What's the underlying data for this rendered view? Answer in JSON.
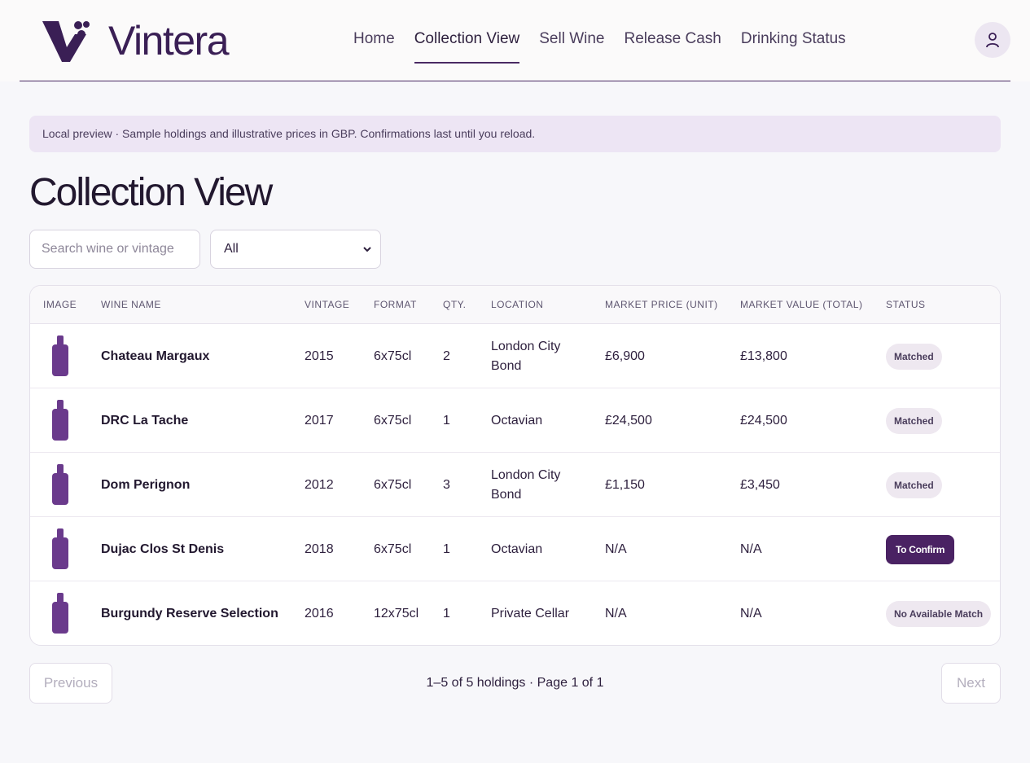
{
  "brand": {
    "name": "Vintera"
  },
  "nav": {
    "items": [
      {
        "label": "Home",
        "active": false
      },
      {
        "label": "Collection View",
        "active": true
      },
      {
        "label": "Sell Wine",
        "active": false
      },
      {
        "label": "Release Cash",
        "active": false
      },
      {
        "label": "Drinking Status",
        "active": false
      }
    ]
  },
  "banner": {
    "text": "Local preview · Sample holdings and illustrative prices in GBP. Confirmations last until you reload."
  },
  "page": {
    "title": "Collection View"
  },
  "filters": {
    "search_placeholder": "Search wine or vintage",
    "select_value": "All"
  },
  "table": {
    "columns": [
      "IMAGE",
      "WINE NAME",
      "VINTAGE",
      "FORMAT",
      "QTY.",
      "LOCATION",
      "MARKET PRICE (UNIT)",
      "MARKET VALUE (TOTAL)",
      "STATUS"
    ],
    "rows": [
      {
        "name": "Chateau Margaux",
        "vintage": "2015",
        "format": "6x75cl",
        "qty": "2",
        "location": "London City Bond",
        "price": "£6,900",
        "value": "£13,800",
        "status": "Matched",
        "status_kind": "matched"
      },
      {
        "name": "DRC La Tache",
        "vintage": "2017",
        "format": "6x75cl",
        "qty": "1",
        "location": "Octavian",
        "price": "£24,500",
        "value": "£24,500",
        "status": "Matched",
        "status_kind": "matched"
      },
      {
        "name": "Dom Perignon",
        "vintage": "2012",
        "format": "6x75cl",
        "qty": "3",
        "location": "London City Bond",
        "price": "£1,150",
        "value": "£3,450",
        "status": "Matched",
        "status_kind": "matched"
      },
      {
        "name": "Dujac Clos St Denis",
        "vintage": "2018",
        "format": "6x75cl",
        "qty": "1",
        "location": "Octavian",
        "price": "N/A",
        "value": "N/A",
        "status": "To Confirm",
        "status_kind": "confirm"
      },
      {
        "name": "Burgundy Reserve Selection",
        "vintage": "2016",
        "format": "12x75cl",
        "qty": "1",
        "location": "Private Cellar",
        "price": "N/A",
        "value": "N/A",
        "status": "No Available Match",
        "status_kind": "none"
      }
    ]
  },
  "pagination": {
    "previous_label": "Previous",
    "next_label": "Next",
    "summary": "1–5 of 5 holdings · Page 1 of 1"
  },
  "icons": {
    "logo": "vintera-logo-icon",
    "avatar": "user-icon",
    "bottle": "wine-bottle-icon",
    "select": "chevron-down-icon"
  },
  "colors": {
    "brand": "#3a1f55",
    "bottle": "#6a3a8c",
    "confirm": "#4a2263",
    "banner": "#ede5f4",
    "badge": "#eee8f0"
  }
}
